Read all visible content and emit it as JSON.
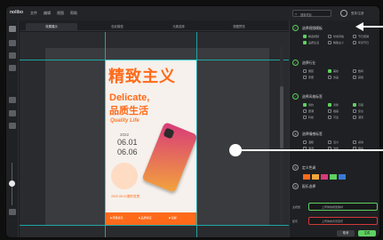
{
  "app": {
    "logo": "nolibo"
  },
  "menu": [
    "文件",
    "编辑",
    "视图",
    "帮助"
  ],
  "search": {
    "placeholder": "搜索项目"
  },
  "account": {
    "login_label": "登录/注册"
  },
  "tabs": [
    {
      "label": "效果展示",
      "active": true
    },
    {
      "label": "色彩模型",
      "active": false
    },
    {
      "label": "元素选择",
      "active": false
    },
    {
      "label": "视图预览",
      "active": false
    }
  ],
  "poster": {
    "title": "精致主义",
    "subtitle_en": "Delicate,",
    "subtitle_cn": "品质生活",
    "tagline": "Quality Life",
    "year": "2022",
    "date_start": "06.01",
    "date_end": "06.06",
    "note": "2022.06.01限时发售",
    "footer": [
      "■ 限量发售",
      "■ 品质保证",
      "■ 包邮"
    ]
  },
  "panel": {
    "sections": [
      {
        "num": "✓",
        "title": "选择视频模板",
        "options": [
          "精选视频",
          "品质生活",
          "时尚风格",
          "精致主义",
          "节日促销",
          "年货节日"
        ],
        "checked": [
          0,
          1
        ]
      },
      {
        "num": "✓",
        "title": "选择行业",
        "options": [
          "服装",
          "美妆",
          "数码",
          "家居",
          "食品",
          "其他"
        ],
        "checked": [
          1
        ]
      },
      {
        "num": "✓",
        "title": "选择风格标签",
        "options": [
          "简约",
          "清新",
          "高级",
          "国潮",
          "插画",
          "复古",
          "科技",
          "可爱",
          "潮流"
        ],
        "checked": [
          0,
          1,
          2
        ]
      },
      {
        "num": "4",
        "title": "选择情感标签",
        "options": [
          "温暖",
          "活力",
          "感动",
          "浪漫",
          "治愈",
          "惊喜"
        ],
        "checked": []
      },
      {
        "num": "5",
        "title": "定义色调",
        "options": [],
        "checked": []
      },
      {
        "num": "6",
        "title": "配乐选择",
        "options": [],
        "checked": []
      }
    ],
    "field1": {
      "label": "主视觉",
      "value": "上传你的视觉素材"
    },
    "field2": {
      "label": "配乐",
      "value": "上传你的背景音乐"
    },
    "buttons": [
      "取消",
      "生成"
    ]
  },
  "colors": {
    "accent": "#5fd061",
    "poster_orange": "#ff6a1a",
    "guide": "#19c2c2"
  }
}
